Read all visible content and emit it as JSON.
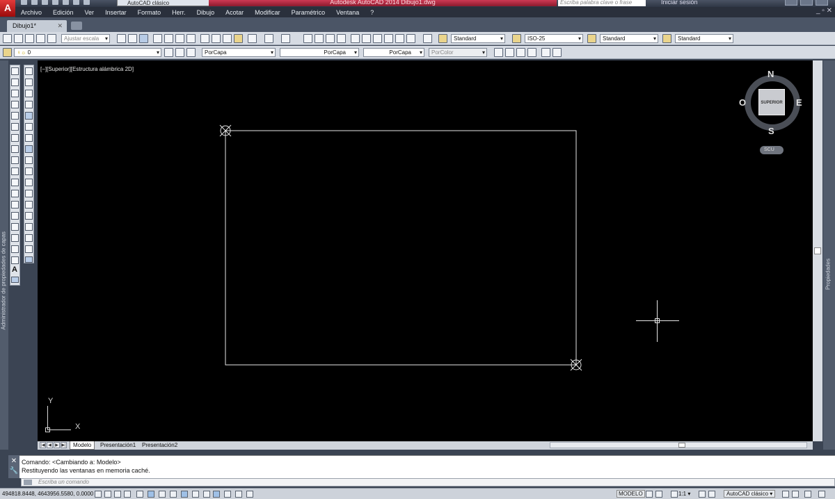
{
  "title_bar": {
    "app_logo": "A",
    "workspace": "AutoCAD clásico",
    "window_title": "Autodesk AutoCAD 2014   Dibujo1.dwg",
    "search_placeholder": "Escriba palabra clave o frase",
    "login": "Iniciar sesión",
    "doc_controls": "_ ▫ ✕"
  },
  "menu": [
    "Archivo",
    "Edición",
    "Ver",
    "Insertar",
    "Formato",
    "Herr.",
    "Dibujo",
    "Acotar",
    "Modificar",
    "Paramétrico",
    "Ventana",
    "?"
  ],
  "tabs": {
    "active": "Dibujo1*",
    "close": "✕"
  },
  "toolbar1": {
    "scale_placeholder": "Ajustar escala",
    "text_style": "Standard",
    "dim_style": "ISO-25",
    "table_style": "Standard",
    "mleader_style": "Standard"
  },
  "toolbar2": {
    "layer": "0",
    "color": "PorCapa",
    "linetype": "PorCapa",
    "lineweight": "PorCapa",
    "plotstyle": "PorColor"
  },
  "left_panel_label": "Administrador de propiedades de capas",
  "right_panel_label": "Propiedades",
  "viewport": {
    "label": "[−][Superior][Estructura alámbrica 2D]"
  },
  "viewcube": {
    "face": "SUPERIOR",
    "north": "N",
    "south": "S",
    "east": "E",
    "west": "O",
    "ucs": "SCU"
  },
  "ucs_icon": {
    "x": "X",
    "y": "Y"
  },
  "layout_tabs": [
    "Modelo",
    "Presentación1",
    "Presentación2"
  ],
  "command": {
    "history": [
      "Comando:   <Cambiando a: Modelo>",
      "Restituyendo las ventanas en memoria caché."
    ],
    "placeholder": "Escriba un comando",
    "close": "✕"
  },
  "status": {
    "coordinates": "494818.8448, 4643956.5580, 0.0000",
    "space": "MODELO",
    "annotation_scale": "1:1 ▾",
    "workspace": "AutoCAD clásico ▾"
  }
}
